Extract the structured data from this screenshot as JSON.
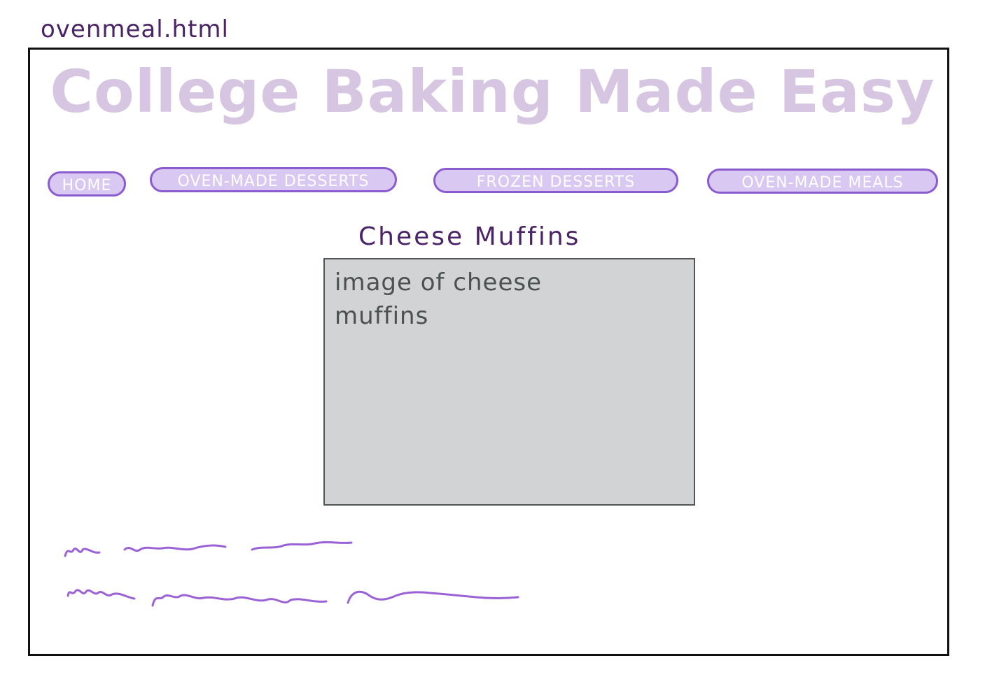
{
  "file_label": "ovenmeal.html",
  "site_title": "College Baking Made Easy",
  "nav": {
    "items": [
      {
        "label": "HOME"
      },
      {
        "label": "OVEN-MADE DESSERTS"
      },
      {
        "label": "FROZEN DESSERTS"
      },
      {
        "label": "OVEN-MADE MEALS"
      }
    ]
  },
  "recipe": {
    "title": "Cheese Muffins",
    "image_placeholder": "image of cheese muffins"
  },
  "colors": {
    "title": "#d6c6e2",
    "nav_fill": "#d9c8f2",
    "nav_border": "#8a5ccf",
    "heading": "#4a2466",
    "placeholder_fill": "#d2d3d5",
    "squiggle": "#9b62d6"
  }
}
